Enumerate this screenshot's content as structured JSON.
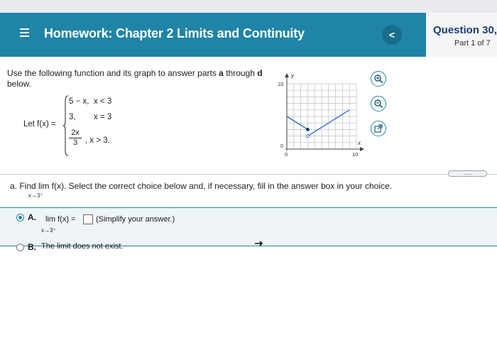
{
  "header": {
    "title": "Homework: Chapter 2 Limits and Continuity",
    "back_label": "<"
  },
  "question_panel": {
    "title": "Question 30,",
    "part": "Part 1 of 7"
  },
  "instructions": {
    "text_before": "Use the following function and its graph to answer parts ",
    "bold_a": "a",
    "text_mid": " through ",
    "bold_d": "d",
    "text_after": "below."
  },
  "function": {
    "let": "Let f(x) =",
    "case1_expr": "5 − x,",
    "case1_cond": "x < 3",
    "case2_expr": "3,",
    "case2_cond": "x = 3",
    "case3_num": "2x",
    "case3_den": "3",
    "case3_cond": ", x > 3."
  },
  "graph": {
    "y_axis_label": "y",
    "x_axis_label": "x",
    "y_top_tick": "10",
    "y_bottom_tick": "0",
    "x_left_tick": "0",
    "x_right_tick": "10"
  },
  "tools": [
    "zoom-in-icon",
    "zoom-out-icon",
    "pop-out-icon"
  ],
  "divider": {
    "label": "....."
  },
  "question_a": {
    "text": "a. Find  lim  f(x). Select the correct choice below and, if necessary, fill in the answer box in your choice.",
    "sub": "x→3⁺"
  },
  "choices": [
    {
      "letter": "A.",
      "lim": "lim  f(x) =",
      "sub": "x→3⁺",
      "answer": "",
      "hint": "(Simplify your answer.)",
      "selected": true
    },
    {
      "letter": "B.",
      "text": "The limit does not exist.",
      "selected": false
    }
  ]
}
